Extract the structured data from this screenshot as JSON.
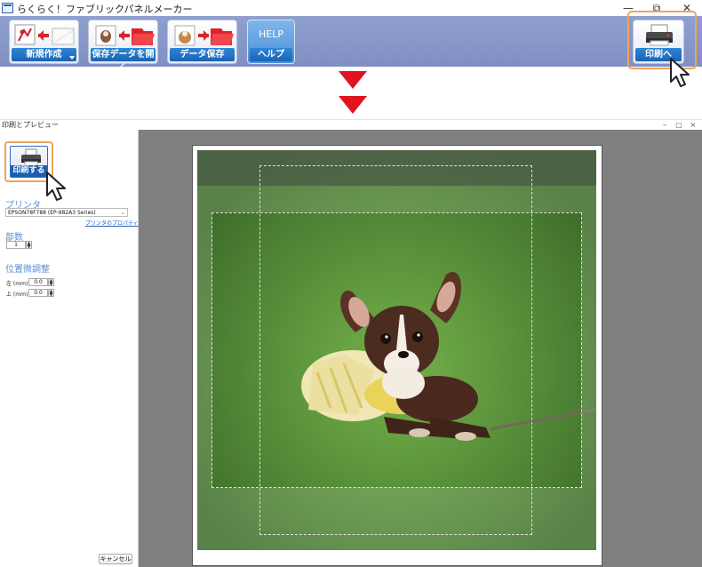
{
  "app": {
    "title": "らくらく！ファブリックパネルメーカー",
    "window_controls": [
      "—",
      "⧉",
      "✕"
    ]
  },
  "toolbar": {
    "new_label": "新規作成",
    "open_label": "保存データを開く",
    "save_label": "データ保存",
    "help_title": "HELP",
    "help_label": "ヘルプ",
    "print_label": "印刷へ"
  },
  "preview_window": {
    "title": "印刷とプレビュー",
    "window_controls": [
      "–",
      "▢",
      "×"
    ],
    "print_button_label": "印刷する",
    "printer_section": "プリンタ",
    "printer_value": "EPSON78F788 (EP-982A3 Series)",
    "printer_properties_link": "プリンタのプロパティ",
    "copies_section": "部数",
    "copies_value": "1",
    "position_section": "位置微調整",
    "left_label": "左 (mm)",
    "left_value": "0.0",
    "top_label": "上 (mm)",
    "top_value": "0.0",
    "cancel_label": "キャンセル"
  },
  "colors": {
    "toolbar": "#8a9bcb",
    "highlight": "#f0a35a",
    "arrow": "#e0141e",
    "button_label_bg": "#1a64b4",
    "section_title": "#5a8fd0",
    "preview_bg": "#808080"
  },
  "icons": [
    "new-file-icon",
    "open-data-icon",
    "save-data-icon",
    "printer-icon",
    "mouse-cursor-icon",
    "arrow-down-icon"
  ]
}
